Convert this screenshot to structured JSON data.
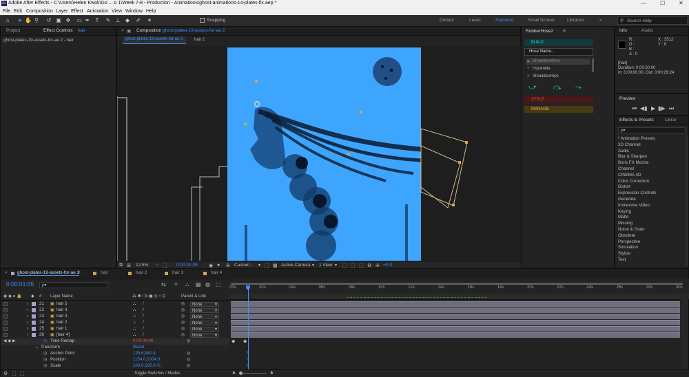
{
  "title_bar": {
    "app_title": "Adobe After Effects - C:\\Users\\Helen Kwok\\Go ... o 1\\Week 7-8 - Production - Animations\\ghost-animations-14-plates-fix.aep *",
    "minimize": "—",
    "maximize": "☐",
    "close": "✕"
  },
  "menu": [
    "File",
    "Edit",
    "Composition",
    "Layer",
    "Effect",
    "Animation",
    "View",
    "Window",
    "Help"
  ],
  "toolbar": {
    "snapping_label": "Snapping",
    "workspaces": [
      "Default",
      "Learn",
      "Standard",
      "Small Screen",
      "Libraries"
    ],
    "active_workspace": "Standard",
    "search_placeholder": "Search Help"
  },
  "left_panel": {
    "tab_project": "Project",
    "tab_effect_controls": "Effect Controls",
    "tab_effect_controls_target": "hair",
    "subtitle": "ghost-plates-19-assets-for-ae 2 - hair"
  },
  "composition_panel": {
    "tab_prefix": "Composition",
    "tab_name": "ghost-plates-19-assets-for-ae 2",
    "subtabs": [
      "ghost-plates-19-assets-for-ae 2",
      "hair 2"
    ],
    "zoom": "12.5%",
    "timecode": "0:00:01:05",
    "resolution": "Custom...",
    "camera": "Active Camera",
    "view": "1 View",
    "exposure": "+0.0"
  },
  "rubberhose": {
    "title": "RubberHose2",
    "build_label": "BUILD",
    "hose_name_placeholder": "Hose Name...",
    "options": [
      "Shoulder/Wrist",
      "Hip/Ankle",
      "Shoulder/Hips"
    ],
    "style_label": "STYLE",
    "manage_label": "MANAGE"
  },
  "info_panel": {
    "tab_info": "Info",
    "tab_audio": "Audio",
    "r": "R :",
    "g": "G :",
    "b": "B :",
    "a": "A : 0",
    "x": "X : 3512",
    "y": "Y : 8",
    "layer": "[hair]",
    "duration": "Duration: 0:00:30:00",
    "in_out": "In: 0:00:00:00, Out: 0:00:29:24"
  },
  "preview_panel": {
    "title": "Preview"
  },
  "effects_panel": {
    "tab": "Effects & Presets",
    "tab2": "Librar",
    "search_placeholder": "ρ▾",
    "categories": [
      "* Animation Presets",
      "3D Channel",
      "Audio",
      "Blur & Sharpen",
      "Boris FX Mocha",
      "Channel",
      "CINEMA 4D",
      "Color Correction",
      "Distort",
      "Expression Controls",
      "Generate",
      "Immersive Video",
      "Keying",
      "Matte",
      "Missing",
      "Noise & Grain",
      "Obsolete",
      "Perspective",
      "Simulation",
      "Stylize",
      "Text"
    ]
  },
  "timeline": {
    "tabs": [
      "ghost-plates-19-assets-for-ae 2",
      "hair",
      "hair 2",
      "hair 3",
      "hair 4"
    ],
    "current_time": "0:00:01:05",
    "col_hash": "#",
    "col_layer_name": "Layer Name",
    "col_parent": "Parent & Link",
    "ruler": [
      "00s",
      "02s",
      "04s",
      "06s",
      "08s",
      "10s",
      "12s",
      "14s",
      "16s",
      "18s",
      "20s",
      "22s",
      "24s",
      "26s",
      "28s",
      "30s"
    ],
    "layers": [
      {
        "num": "21",
        "name": "hair 5",
        "parent": "None"
      },
      {
        "num": "22",
        "name": "hair 4",
        "parent": "None"
      },
      {
        "num": "23",
        "name": "hair 3",
        "parent": "None"
      },
      {
        "num": "24",
        "name": "hair 2",
        "parent": "None"
      },
      {
        "num": "25",
        "name": "hair 1",
        "parent": "None"
      },
      {
        "num": "26",
        "name": "[hair 4]",
        "parent": "None"
      }
    ],
    "time_remap_label": "Time Remap",
    "time_remap_value": "0:00:00:06",
    "transform_label": "Transform",
    "reset_label": "Reset",
    "props": [
      {
        "name": "Anchor Point",
        "value": "135.6,940.4"
      },
      {
        "name": "Position",
        "value": "1154.0,1004.0"
      },
      {
        "name": "Scale",
        "value": "100.0,100.0 %"
      }
    ],
    "toggle_label": "Toggle Switches / Modes"
  }
}
